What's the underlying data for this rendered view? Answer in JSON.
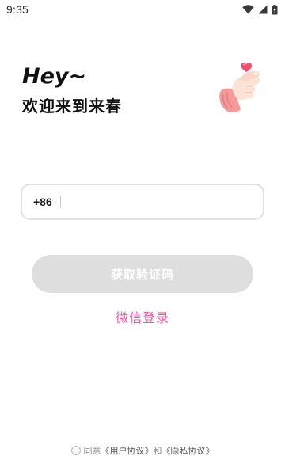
{
  "status_bar": {
    "time": "9:35",
    "icons": [
      "wifi-icon",
      "signal-icon",
      "battery-icon"
    ]
  },
  "greeting": {
    "hey": "Hey~",
    "welcome": "欢迎来到来春"
  },
  "phone_field": {
    "country_code": "+86",
    "value": "",
    "placeholder": ""
  },
  "get_code_button": {
    "label": "获取验证码",
    "enabled": false
  },
  "wechat_login": {
    "label": "微信登录"
  },
  "agreement": {
    "checked": false,
    "prefix": "同意",
    "user_agreement": "《用户协议》",
    "conjunction": "和",
    "privacy_agreement": "《隐私协议》"
  },
  "colors": {
    "accent_pink": "#f0559a",
    "button_disabled": "#dedede",
    "field_border": "#e2e2e2",
    "heart": "#f2506a"
  }
}
